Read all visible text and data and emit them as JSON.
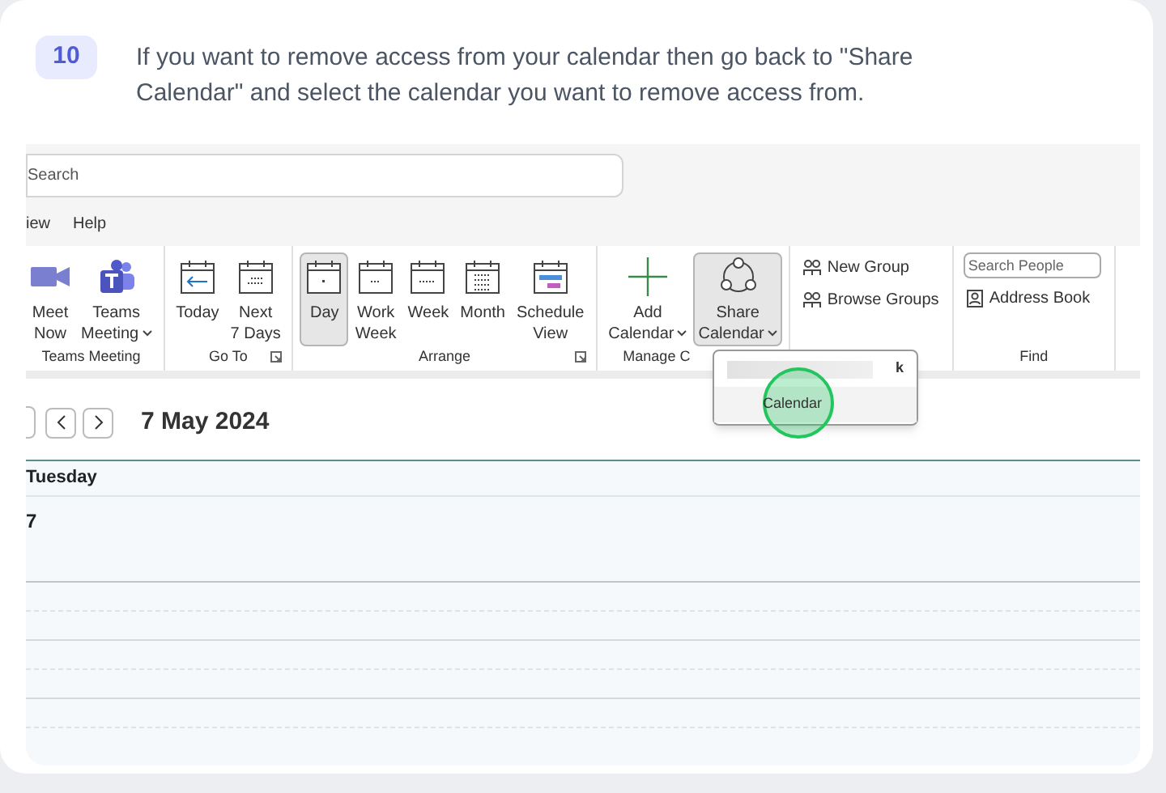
{
  "step": {
    "number": "10",
    "text": "If you want to remove access from your calendar then go back to \"Share Calendar\" and select the calendar you want to remove access from."
  },
  "screenshot": {
    "search": {
      "placeholder": "Search"
    },
    "menu": [
      "iew",
      "Help"
    ],
    "ribbon": [
      {
        "label": "Teams Meeting",
        "launcher": false,
        "buttons": [
          {
            "kind": "video",
            "lines": [
              "Meet",
              "Now"
            ],
            "dropdown": false,
            "selected": false
          },
          {
            "kind": "teams",
            "lines": [
              "Teams",
              "Meeting"
            ],
            "dropdown": true,
            "selected": false
          }
        ]
      },
      {
        "label": "Go To",
        "launcher": true,
        "buttons": [
          {
            "kind": "today",
            "lines": [
              "Today"
            ],
            "dropdown": false,
            "selected": false
          },
          {
            "kind": "next7",
            "lines": [
              "Next",
              "7 Days"
            ],
            "dropdown": false,
            "selected": false
          }
        ]
      },
      {
        "label": "Arrange",
        "launcher": true,
        "buttons": [
          {
            "kind": "day",
            "lines": [
              "Day"
            ],
            "dropdown": false,
            "selected": true
          },
          {
            "kind": "workweek",
            "lines": [
              "Work",
              "Week"
            ],
            "dropdown": false,
            "selected": false
          },
          {
            "kind": "week",
            "lines": [
              "Week"
            ],
            "dropdown": false,
            "selected": false
          },
          {
            "kind": "month",
            "lines": [
              "Month"
            ],
            "dropdown": false,
            "selected": false
          },
          {
            "kind": "schedule",
            "lines": [
              "Schedule",
              "View"
            ],
            "dropdown": false,
            "selected": false
          }
        ]
      },
      {
        "label": "Manage C",
        "launcher": false,
        "buttons": [
          {
            "kind": "plus",
            "lines": [
              "Add",
              "Calendar"
            ],
            "dropdown": true,
            "selected": false
          },
          {
            "kind": "share",
            "lines": [
              "Share",
              "Calendar"
            ],
            "dropdown": true,
            "selected": true
          }
        ]
      }
    ],
    "groups_panel": {
      "items": [
        "New Group",
        "Browse Groups"
      ]
    },
    "find": {
      "label": "Find",
      "search": {
        "placeholder": "Search People"
      },
      "address_book": "Address Book"
    },
    "share_menu": [
      {
        "kind": "redacted",
        "text": "k",
        "highlighted": false
      },
      {
        "kind": "item",
        "text": "Calendar",
        "highlighted": true
      }
    ],
    "date": "7 May 2024",
    "day": {
      "name": "Tuesday",
      "number": "7"
    }
  }
}
